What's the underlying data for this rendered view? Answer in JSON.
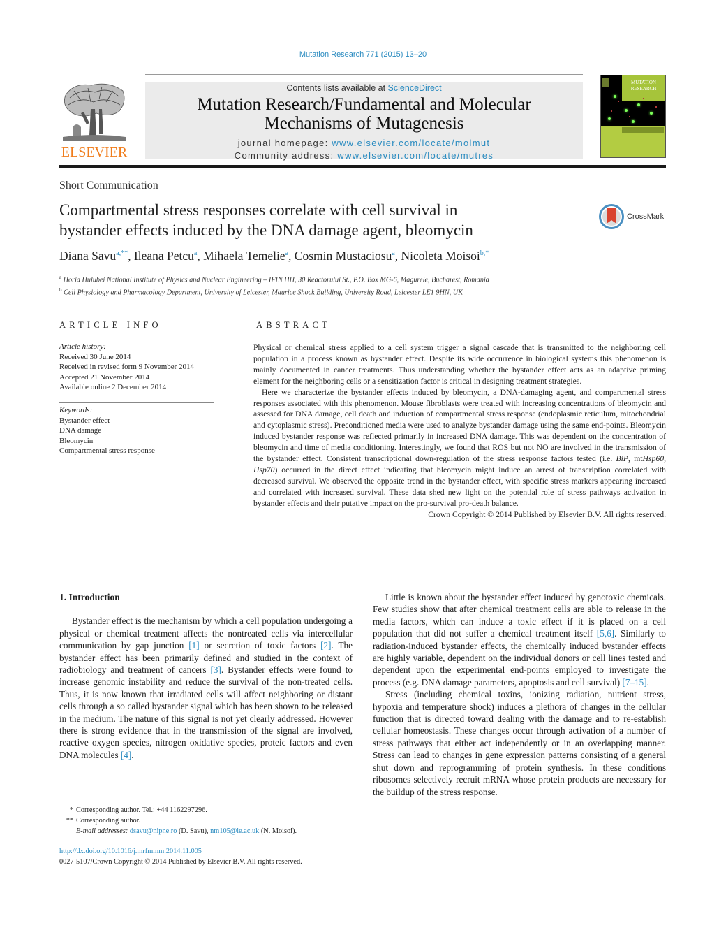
{
  "header": {
    "citation": "Mutation Research 771 (2015) 13–20",
    "contents_prefix": "Contents lists available at ",
    "contents_link": "ScienceDirect",
    "journal_title_line1": "Mutation Research/Fundamental and Molecular",
    "journal_title_line2": "Mechanisms of Mutagenesis",
    "homepage_label": "journal homepage: ",
    "homepage_url": "www.elsevier.com/locate/molmut",
    "community_label": "Community address: ",
    "community_url": "www.elsevier.com/locate/mutres",
    "publisher_logo_text": "ELSEVIER",
    "cover_title_line1": "MUTATION",
    "cover_title_line2": "RESEARCH",
    "colors": {
      "link": "#2a8bc0",
      "elsevier_orange": "#f07d1c",
      "band": "#ebebeb",
      "cover_green": "#b3cc42"
    }
  },
  "article": {
    "section_type": "Short Communication",
    "title_line1": "Compartmental stress responses correlate with cell survival in",
    "title_line2": "bystander effects induced by the DNA damage agent, bleomycin",
    "crossmark_label": "CrossMark",
    "authors": [
      {
        "name": "Diana Savu",
        "sup": "a,**"
      },
      {
        "name": "Ileana Petcu",
        "sup": "a"
      },
      {
        "name": "Mihaela Temelie",
        "sup": "a"
      },
      {
        "name": "Cosmin Mustaciosu",
        "sup": "a"
      },
      {
        "name": "Nicoleta Moisoi",
        "sup": "b,*"
      }
    ],
    "affiliations": [
      {
        "mark": "a",
        "text": "Horia Hulubei National Institute of Physics and Nuclear Engineering – IFIN HH, 30 Reactorului St., P.O. Box MG-6, Magurele, Bucharest, Romania"
      },
      {
        "mark": "b",
        "text": "Cell Physiology and Pharmacology Department, University of Leicester, Maurice Shock Building, University Road, Leicester LE1 9HN, UK"
      }
    ]
  },
  "article_info": {
    "heading": "ARTICLE INFO",
    "history_label": "Article history:",
    "history": [
      "Received 30 June 2014",
      "Received in revised form 9 November 2014",
      "Accepted 21 November 2014",
      "Available online 2 December 2014"
    ],
    "keywords_label": "Keywords:",
    "keywords": [
      "Bystander effect",
      "DNA damage",
      "Bleomycin",
      "Compartmental stress response"
    ]
  },
  "abstract": {
    "heading": "ABSTRACT",
    "p1": "Physical or chemical stress applied to a cell system trigger a signal cascade that is transmitted to the neighboring cell population in a process known as bystander effect. Despite its wide occurrence in biological systems this phenomenon is mainly documented in cancer treatments. Thus understanding whether the bystander effect acts as an adaptive priming element for the neighboring cells or a sensitization factor is critical in designing treatment strategies.",
    "p2_a": "Here we characterize the bystander effects induced by bleomycin, a DNA-damaging agent, and compartmental stress responses associated with this phenomenon. Mouse fibroblasts were treated with increasing concentrations of bleomycin and assessed for DNA damage, cell death and induction of compartmental stress response (endoplasmic reticulum, mitochondrial and cytoplasmic stress). Preconditioned media were used to analyze bystander damage using the same end-points. Bleomycin induced bystander response was reflected primarily in increased DNA damage. This was dependent on the concentration of bleomycin and time of media conditioning. Interestingly, we found that ROS but not NO are involved in the transmission of the bystander effect. Consistent transcriptional down-regulation of the stress response factors tested (i.e. ",
    "gene1": "BiP",
    "sep1": ", mt",
    "gene2": "Hsp60",
    "sep2": ", ",
    "gene3": "Hsp70",
    "p2_b": ") occurred in the direct effect indicating that bleomycin might induce an arrest of transcription correlated with decreased survival. We observed the opposite trend in the bystander effect, with specific stress markers appearing increased and correlated with increased survival. These data shed new light on the potential role of stress pathways activation in bystander effects and their putative impact on the pro-survival pro-death balance.",
    "copyright": "Crown Copyright © 2014 Published by Elsevier B.V. All rights reserved."
  },
  "body": {
    "intro_heading": "1.  Introduction",
    "left_p1_a": "Bystander effect is the mechanism by which a cell population undergoing a physical or chemical treatment affects the nontreated cells via intercellular communication by gap junction ",
    "ref1": "[1]",
    "left_p1_b": " or secretion of toxic factors ",
    "ref2": "[2]",
    "left_p1_c": ". The bystander effect has been primarily defined and studied in the context of radiobiology and treatment of cancers ",
    "ref3": "[3]",
    "left_p1_d": ". Bystander effects were found to increase genomic instability and reduce the survival of the non-treated cells. Thus, it is now known that irradiated cells will affect neighboring or distant cells through a so called bystander signal which has been shown to be released in the medium. The nature of this signal is not yet clearly addressed. However there is strong evidence that in the transmission of the signal are involved, reactive oxygen species, nitrogen oxidative species, proteic factors and even DNA molecules ",
    "ref4": "[4]",
    "left_p1_e": ".",
    "right_p1_a": "Little is known about the bystander effect induced by genotoxic chemicals. Few studies show that after chemical treatment cells are able to release in the media factors, which can induce a toxic effect if it is placed on a cell population that did not suffer a chemical treatment itself ",
    "ref56": "[5,6]",
    "right_p1_b": ". Similarly to radiation-induced bystander effects, the chemically induced bystander effects are highly variable, dependent on the individual donors or cell lines tested and dependent upon the experimental end-points employed to investigate the process (e.g. DNA damage parameters, apoptosis and cell survival) ",
    "ref715": "[7–15]",
    "right_p1_c": ".",
    "right_p2": "Stress (including chemical toxins, ionizing radiation, nutrient stress, hypoxia and temperature shock) induces a plethora of changes in the cellular function that is directed toward dealing with the damage and to re-establish cellular homeostasis. These changes occur through activation of a number of stress pathways that either act independently or in an overlapping manner. Stress can lead to changes in gene expression patterns consisting of a general shut down and reprogramming of protein synthesis. In these conditions ribosomes selectively recruit mRNA whose protein products are necessary for the buildup of the stress response."
  },
  "footnotes": {
    "fn1_mark": "*",
    "fn1_text": "Corresponding author. Tel.: +44 1162297296.",
    "fn2_mark": "**",
    "fn2_text": "Corresponding author.",
    "email_label": "E-mail addresses: ",
    "email1": "dsavu@nipne.ro",
    "email1_owner": " (D. Savu), ",
    "email2": "nm105@le.ac.uk",
    "email2_owner": " (N. Moisoi).",
    "doi": "http://dx.doi.org/10.1016/j.mrfmmm.2014.11.005",
    "issn_copyright": "0027-5107/Crown Copyright © 2014 Published by Elsevier B.V. All rights reserved."
  }
}
